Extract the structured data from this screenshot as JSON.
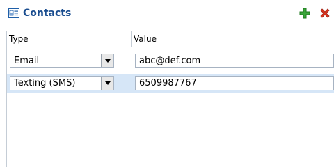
{
  "panel": {
    "title": "Contacts",
    "icons": {
      "title": "contacts-card-icon",
      "add": "add-plus-icon",
      "delete": "delete-x-icon"
    },
    "colors": {
      "title": "#1a4d8f",
      "add": "#3aa63a",
      "delete": "#d9341f",
      "selected_row": "#d6e6f7"
    }
  },
  "table": {
    "columns": [
      "Type",
      "Value"
    ],
    "rows": [
      {
        "type": "Email",
        "value": "abc@def.com",
        "selected": false
      },
      {
        "type": "Texting (SMS)",
        "value": "6509987767",
        "selected": true
      }
    ]
  }
}
